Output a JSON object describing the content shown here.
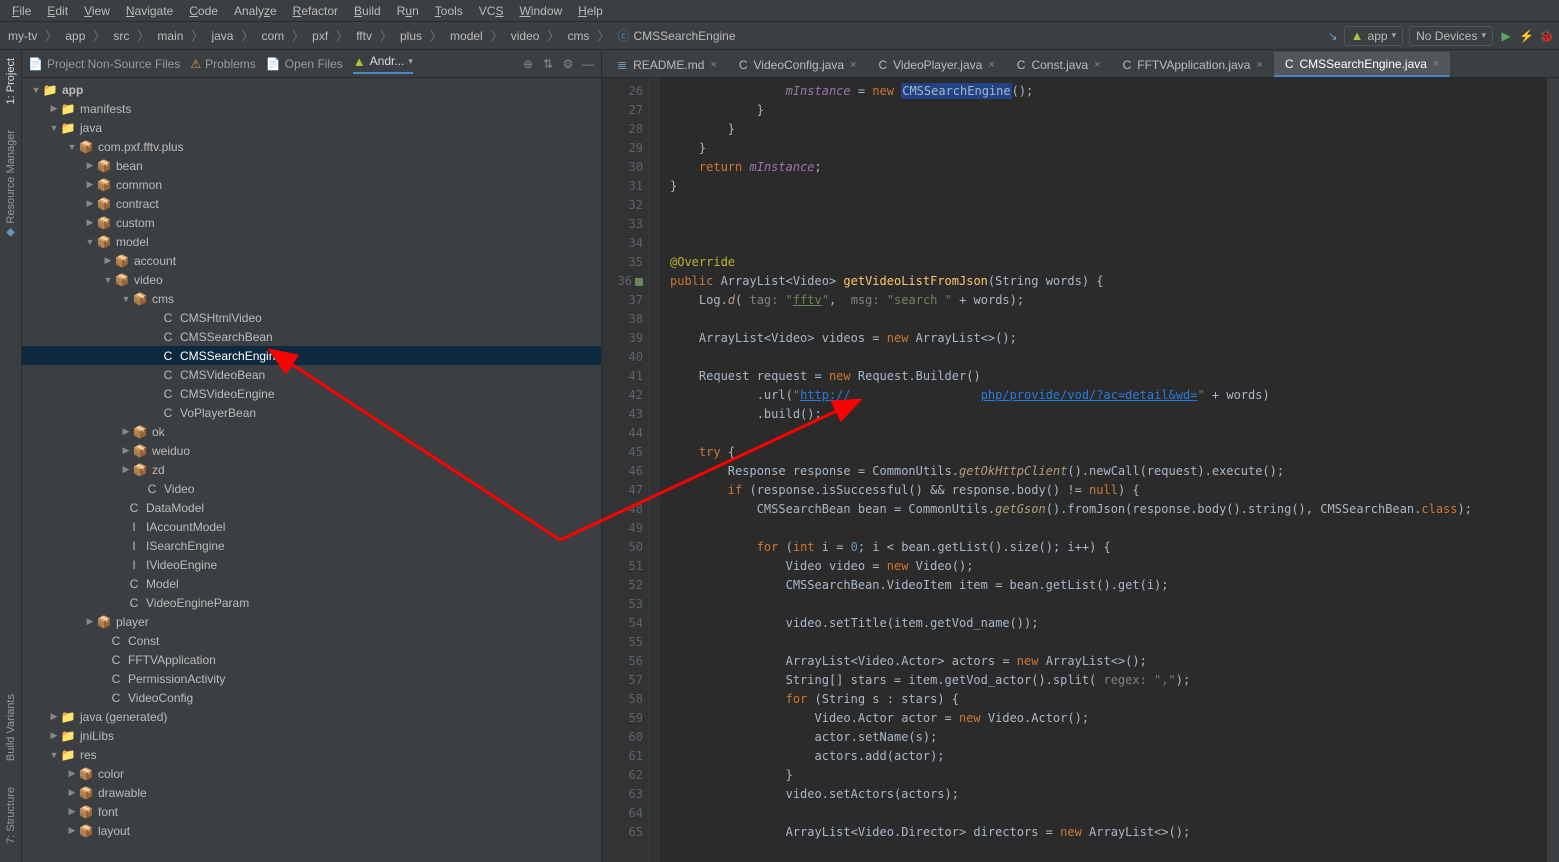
{
  "menu": [
    "File",
    "Edit",
    "View",
    "Navigate",
    "Code",
    "Analyze",
    "Refactor",
    "Build",
    "Run",
    "Tools",
    "VCS",
    "Window",
    "Help"
  ],
  "breadcrumb": {
    "items": [
      "my-tv",
      "app",
      "src",
      "main",
      "java",
      "com",
      "pxf",
      "fftv",
      "plus",
      "model",
      "video",
      "cms",
      "CMSSearchEngine"
    ]
  },
  "run": {
    "config": "app",
    "devices": "No Devices"
  },
  "rails": {
    "left_top": [
      "1: Project",
      "Resource Manager"
    ],
    "left_bottom": [
      "7: Structure",
      "Build Variants"
    ]
  },
  "proj_tabs": {
    "nonsource": "Project Non-Source Files",
    "problems": "Problems",
    "openfiles": "Open Files",
    "android": "Andr..."
  },
  "tree": {
    "app": "app",
    "manifests": "manifests",
    "java": "java",
    "pkg": "com.pxf.fftv.plus",
    "bean": "bean",
    "common": "common",
    "contract": "contract",
    "custom": "custom",
    "model": "model",
    "account": "account",
    "video": "video",
    "cms": "cms",
    "CMSHtmlVideo": "CMSHtmlVideo",
    "CMSSearchBean": "CMSSearchBean",
    "CMSSearchEngine": "CMSSearchEngine",
    "CMSVideoBean": "CMSVideoBean",
    "CMSVideoEngine": "CMSVideoEngine",
    "VoPlayerBean": "VoPlayerBean",
    "ok": "ok",
    "weiduo": "weiduo",
    "zd": "zd",
    "Video": "Video",
    "DataModel": "DataModel",
    "IAccountModel": "IAccountModel",
    "ISearchEngine": "ISearchEngine",
    "IVideoEngine": "IVideoEngine",
    "Model": "Model",
    "VideoEngineParam": "VideoEngineParam",
    "player": "player",
    "Const": "Const",
    "FFTVApplication": "FFTVApplication",
    "PermissionActivity": "PermissionActivity",
    "VideoConfig": "VideoConfig",
    "java_gen": "java",
    "java_gen_suffix": "(generated)",
    "jniLibs": "jniLibs",
    "res": "res",
    "color": "color",
    "drawable": "drawable",
    "font": "font",
    "layout": "layout"
  },
  "tabs": [
    {
      "label": "README.md",
      "icon": "md"
    },
    {
      "label": "VideoConfig.java",
      "icon": "java"
    },
    {
      "label": "VideoPlayer.java",
      "icon": "java"
    },
    {
      "label": "Const.java",
      "icon": "java"
    },
    {
      "label": "FFTVApplication.java",
      "icon": "java"
    },
    {
      "label": "CMSSearchEngine.java",
      "icon": "java",
      "active": true
    }
  ],
  "line_start": 26,
  "line_end": 65,
  "override_line": 36
}
